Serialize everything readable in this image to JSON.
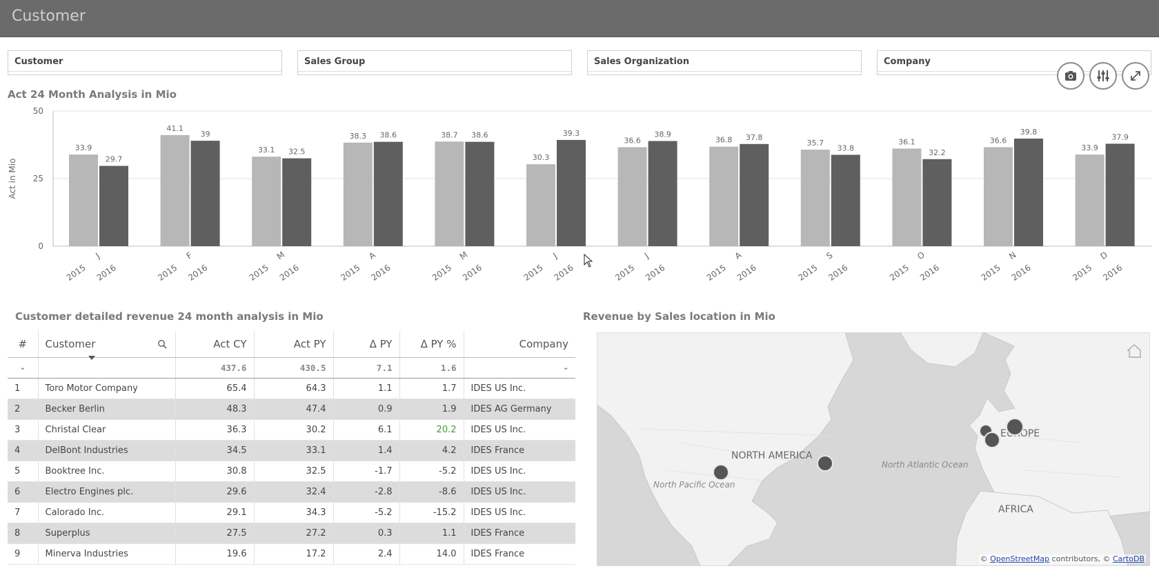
{
  "header": {
    "title": "Customer"
  },
  "filters": [
    "Customer",
    "Sales Group",
    "Sales Organization",
    "Company"
  ],
  "toolbar": {
    "icons": [
      "camera-icon",
      "sliders-icon",
      "expand-icon"
    ]
  },
  "bar_chart": {
    "title": "Act 24 Month Analysis in Mio",
    "ylabel": "Act in Mio"
  },
  "chart_data": {
    "type": "bar",
    "categories": [
      "J",
      "F",
      "M",
      "A",
      "M",
      "J",
      "J",
      "A",
      "S",
      "O",
      "N",
      "D"
    ],
    "sub_categories": [
      "2015",
      "2016"
    ],
    "series": [
      {
        "name": "2015",
        "values": [
          33.9,
          41.1,
          33.1,
          38.3,
          38.7,
          30.3,
          36.6,
          36.8,
          35.7,
          36.1,
          36.6,
          33.9
        ]
      },
      {
        "name": "2016",
        "values": [
          29.7,
          39,
          32.5,
          38.6,
          38.6,
          39.3,
          38.9,
          37.8,
          33.8,
          32.2,
          39.8,
          37.9
        ]
      }
    ],
    "ylim": [
      0,
      50
    ],
    "yticks": [
      0,
      25,
      50
    ],
    "grid": true,
    "colors": {
      "2015": "#b7b7b7",
      "2016": "#5f5f5f"
    }
  },
  "table": {
    "title": "Customer detailed revenue 24 month analysis in Mio",
    "columns": [
      "#",
      "Customer",
      "Act CY",
      "Act PY",
      "Δ PY",
      "Δ PY %",
      "Company"
    ],
    "totals": [
      "-",
      "",
      "437.6",
      "430.5",
      "7.1",
      "1.6",
      "-"
    ],
    "rows": [
      [
        "1",
        "Toro Motor Company",
        "65.4",
        "64.3",
        "1.1",
        "1.7",
        "IDES US Inc."
      ],
      [
        "2",
        "Becker Berlin",
        "48.3",
        "47.4",
        "0.9",
        "1.9",
        "IDES AG Germany"
      ],
      [
        "3",
        "Christal Clear",
        "36.3",
        "30.2",
        "6.1",
        "20.2",
        "IDES US Inc."
      ],
      [
        "4",
        "DelBont Industries",
        "34.5",
        "33.1",
        "1.4",
        "4.2",
        "IDES France"
      ],
      [
        "5",
        "Booktree Inc.",
        "30.8",
        "32.5",
        "-1.7",
        "-5.2",
        "IDES US Inc."
      ],
      [
        "6",
        "Electro Engines plc.",
        "29.6",
        "32.4",
        "-2.8",
        "-8.6",
        "IDES US Inc."
      ],
      [
        "7",
        "Calorado Inc.",
        "29.1",
        "34.3",
        "-5.2",
        "-15.2",
        "IDES US Inc."
      ],
      [
        "8",
        "Superplus",
        "27.5",
        "27.2",
        "0.3",
        "1.1",
        "IDES France"
      ],
      [
        "9",
        "Minerva Industries",
        "19.6",
        "17.2",
        "2.4",
        "14.0",
        "IDES France"
      ]
    ],
    "highlight_color": "#3a9a3a"
  },
  "map": {
    "title": "Revenue by Sales location in Mio",
    "labels": [
      "NORTH AMERICA",
      "EUROPE",
      "AFRICA",
      "North Atlantic Ocean",
      "North Pacific Ocean"
    ],
    "attribution": {
      "prefix": "©",
      "osm": "OpenStreetMap",
      "middle": "contributors, ©",
      "carto": "CartoDB"
    }
  }
}
